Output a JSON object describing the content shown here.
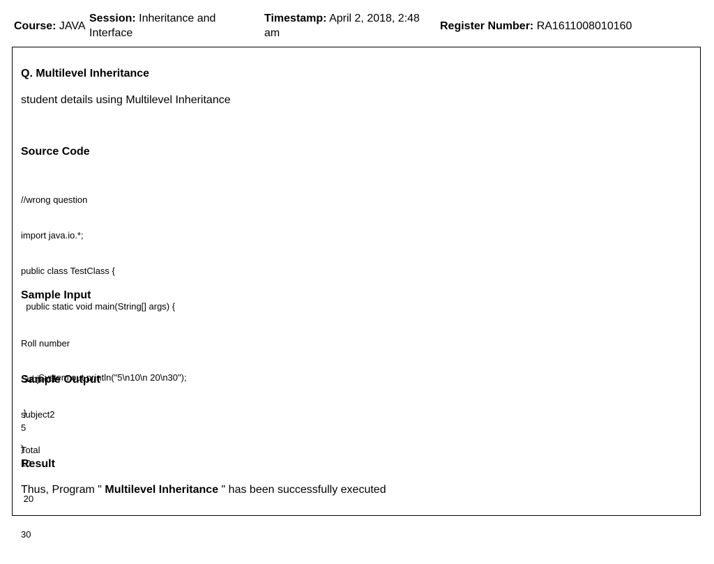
{
  "header": {
    "course_label": "Course:",
    "course_value": "JAVA",
    "session_label": "Session:",
    "session_value": "Inheritance and Interface",
    "timestamp_label": "Timestamp:",
    "timestamp_value": "April 2, 2018, 2:48 am",
    "register_label": "Register Number:",
    "register_value": "RA1611008010160"
  },
  "question": {
    "title": "Q. Multilevel Inheritance",
    "description": "student details using Multilevel Inheritance"
  },
  "source_code": {
    "title": "Source Code",
    "lines": [
      "//wrong question",
      "import java.io.*;",
      "public class TestClass {",
      "  public static void main(String[] args) {",
      "",
      "       System.out.println(\"5\\n10\\n 20\\n30\");",
      " }",
      "}"
    ]
  },
  "sample_input": {
    "title": "Sample Input",
    "lines": [
      "Roll number",
      "Subject1",
      "subject2",
      "Total"
    ]
  },
  "sample_output": {
    "title": "Sample Output",
    "lines": [
      "5",
      "10",
      " 20",
      "30"
    ]
  },
  "result": {
    "title": "Result",
    "prefix": "Thus, Program \" ",
    "program_name": "Multilevel Inheritance",
    "suffix": " \" has been successfully executed"
  }
}
